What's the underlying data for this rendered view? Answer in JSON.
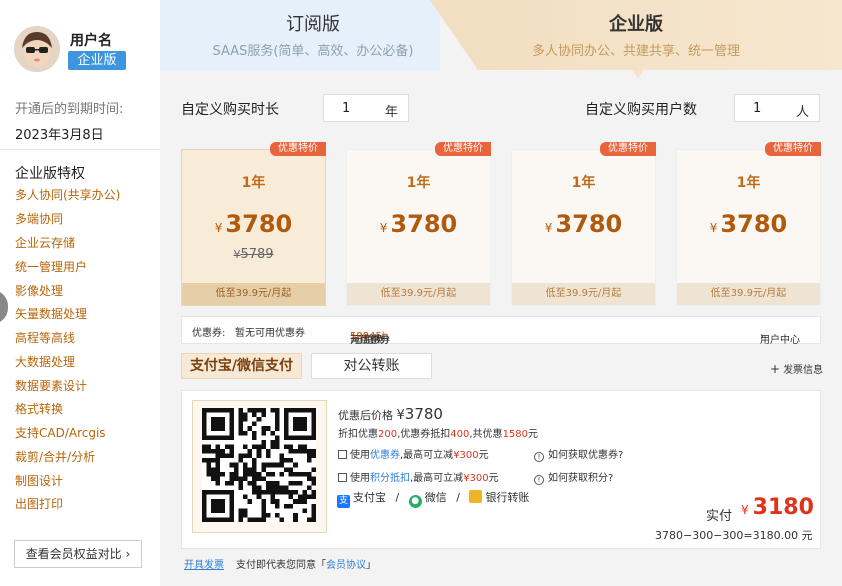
{
  "user": {
    "name": "用户名",
    "badge": "企业版"
  },
  "expiry": {
    "label": "开通后的到期时间:",
    "date": "2023年3月8日"
  },
  "features": {
    "title": "企业版特权",
    "items": [
      "多人协同(共享办公)",
      "多端协同",
      "企业云存储",
      "统一管理用户",
      "影像处理",
      "矢量数据处理",
      "高程等高线",
      "大数据处理",
      "数据要素设计",
      "格式转换",
      "支持CAD/Arcgis",
      "裁剪/合并/分析",
      "制图设计",
      "出图打印"
    ],
    "button": "查看会员权益对比"
  },
  "tabs": {
    "subscription": {
      "title": "订阅版",
      "subtitle": "SAAS服务(简单、高效、办公必备)"
    },
    "enterprise": {
      "title": "企业版",
      "subtitle": "多人协同办公、共建共享、统一管理"
    }
  },
  "duration": {
    "label": "自定义购买时长",
    "value": "1",
    "unit": "年"
  },
  "users": {
    "label": "自定义购买用户数",
    "value": "1",
    "unit": "人"
  },
  "cards": [
    {
      "ribbon": "优惠特价",
      "term": "1年",
      "currency": "¥",
      "price": "3780",
      "original": "5789",
      "foot": "低至39.9元/月起"
    },
    {
      "ribbon": "优惠特价",
      "term": "1年",
      "currency": "¥",
      "price": "3780",
      "original": "",
      "foot": "低至39.9元/月起"
    },
    {
      "ribbon": "优惠特价",
      "term": "1年",
      "currency": "¥",
      "price": "3780",
      "original": "",
      "foot": "低至39.9元/月起"
    },
    {
      "ribbon": "优惠特价",
      "term": "1年",
      "currency": "¥",
      "price": "3780",
      "original": "",
      "foot": "低至39.9元/月起"
    }
  ],
  "coupon_bar": {
    "label": "优惠券:",
    "status": "暂无可用优惠券",
    "points_pre": "可用积分",
    "points": "12345b",
    "points_mid": ",可兑换",
    "points_amount": "500",
    "points_post": "元优惠券",
    "user_center": "用户中心"
  },
  "payment_tabs": {
    "online": "支付宝/微信支付",
    "transfer": "对公转账",
    "invoice": "发票信息"
  },
  "payment": {
    "after_label": "优惠后价格",
    "after_currency": "¥",
    "after_price": "3780",
    "discount_pre": "折扣优惠",
    "discount": "200",
    "coupon_pre": ",优惠券抵扣",
    "coupon": "400",
    "total_pre": ",共优惠",
    "total": "1580",
    "total_unit": "元",
    "opt1_pre": "使用",
    "opt1_link": "优惠券",
    "opt1_mid": ",最高可立减",
    "opt1_amount": "¥300",
    "opt1_unit": "元",
    "help1": "如何获取优惠券?",
    "opt2_pre": "使用",
    "opt2_link": "积分抵扣",
    "opt2_mid": ",最高可立减",
    "opt2_amount": "¥300",
    "opt2_unit": "元",
    "help2": "如何获取积分?",
    "methods": [
      "支付宝",
      "微信",
      "银行转账"
    ],
    "method_sep": "/",
    "paid_label": "实付",
    "paid_currency": "¥",
    "paid_amount": "3180",
    "calc": "3780−300−300=3180.00 元"
  },
  "footer": {
    "invoice_link": "开具发票",
    "agree_pre": "支付即代表您同意「",
    "agreement": "会员协议",
    "agree_post": "」"
  }
}
